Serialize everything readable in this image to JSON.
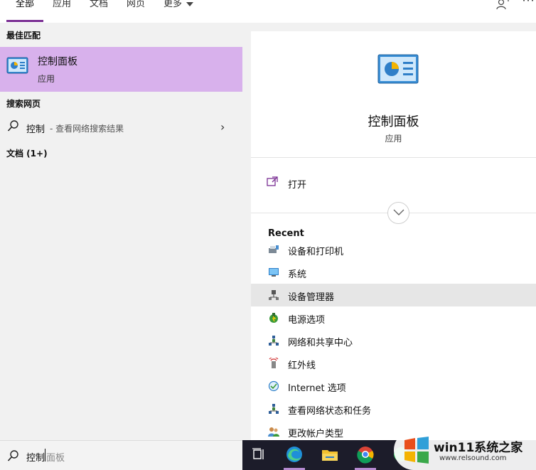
{
  "tabs": [
    {
      "label": "全部",
      "active": true
    },
    {
      "label": "应用"
    },
    {
      "label": "文档"
    },
    {
      "label": "网页"
    },
    {
      "label": "更多"
    }
  ],
  "left": {
    "best_match_heading": "最佳匹配",
    "best_match": {
      "title": "控制面板",
      "subtitle": "应用"
    },
    "web_heading": "搜索网页",
    "web_result": {
      "query": "控制",
      "hint": " - 查看网络搜索结果"
    },
    "docs_heading": "文档 (1+)"
  },
  "detail": {
    "title": "控制面板",
    "subtitle": "应用",
    "open_label": "打开",
    "recent_heading": "Recent",
    "recent": [
      {
        "label": "设备和打印机",
        "icon": "devices-printers-icon"
      },
      {
        "label": "系统",
        "icon": "system-monitor-icon"
      },
      {
        "label": "设备管理器",
        "icon": "device-manager-icon",
        "highlighted": true
      },
      {
        "label": "电源选项",
        "icon": "power-options-icon"
      },
      {
        "label": "网络和共享中心",
        "icon": "network-sharing-icon"
      },
      {
        "label": "红外线",
        "icon": "infrared-icon"
      },
      {
        "label": "Internet 选项",
        "icon": "internet-options-icon"
      },
      {
        "label": "查看网络状态和任务",
        "icon": "network-status-icon"
      },
      {
        "label": "更改帐户类型",
        "icon": "user-accounts-icon"
      }
    ]
  },
  "search": {
    "typed": "控制",
    "suggestion": "面板"
  },
  "watermark": {
    "text": "win11系统之家",
    "url": "www.relsound.com"
  },
  "colors": {
    "accent": "#7a2e93",
    "selection": "#d8b1ec",
    "taskbar": "#1c1c2a"
  }
}
